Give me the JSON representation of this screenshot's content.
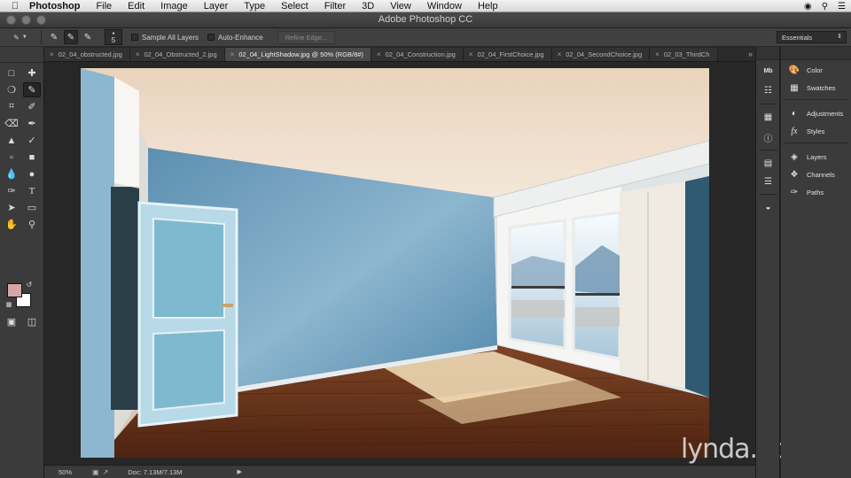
{
  "menubar": {
    "items": [
      "Photoshop",
      "File",
      "Edit",
      "Image",
      "Layer",
      "Type",
      "Select",
      "Filter",
      "3D",
      "View",
      "Window",
      "Help"
    ]
  },
  "window": {
    "title": "Adobe Photoshop CC"
  },
  "options": {
    "brush_size": "5",
    "sample_all_layers": "Sample All Layers",
    "auto_enhance": "Auto-Enhance",
    "refine_edge": "Refine Edge...",
    "workspace": "Essentials"
  },
  "tabs": [
    {
      "label": "02_04_obstructed.jpg",
      "active": false
    },
    {
      "label": "02_04_Obstructed_2.jpg",
      "active": false
    },
    {
      "label": "02_04_LightShadow.jpg @ 50% (RGB/8#)",
      "active": true
    },
    {
      "label": "02_04_Construction.jpg",
      "active": false
    },
    {
      "label": "02_04_FirstChoice.jpg",
      "active": false
    },
    {
      "label": "02_04_SecondChoice.jpg",
      "active": false
    },
    {
      "label": "02_03_ThirdCh",
      "active": false
    }
  ],
  "status": {
    "zoom": "50%",
    "doc_info": "Doc: 7.13M/7.13M"
  },
  "colors": {
    "foreground": "#d6a6a6",
    "background": "#ffffff"
  },
  "panels": {
    "color": "Color",
    "swatches": "Swatches",
    "adjustments": "Adjustments",
    "styles": "Styles",
    "layers": "Layers",
    "channels": "Channels",
    "paths": "Paths"
  },
  "watermark": "lynda.com"
}
